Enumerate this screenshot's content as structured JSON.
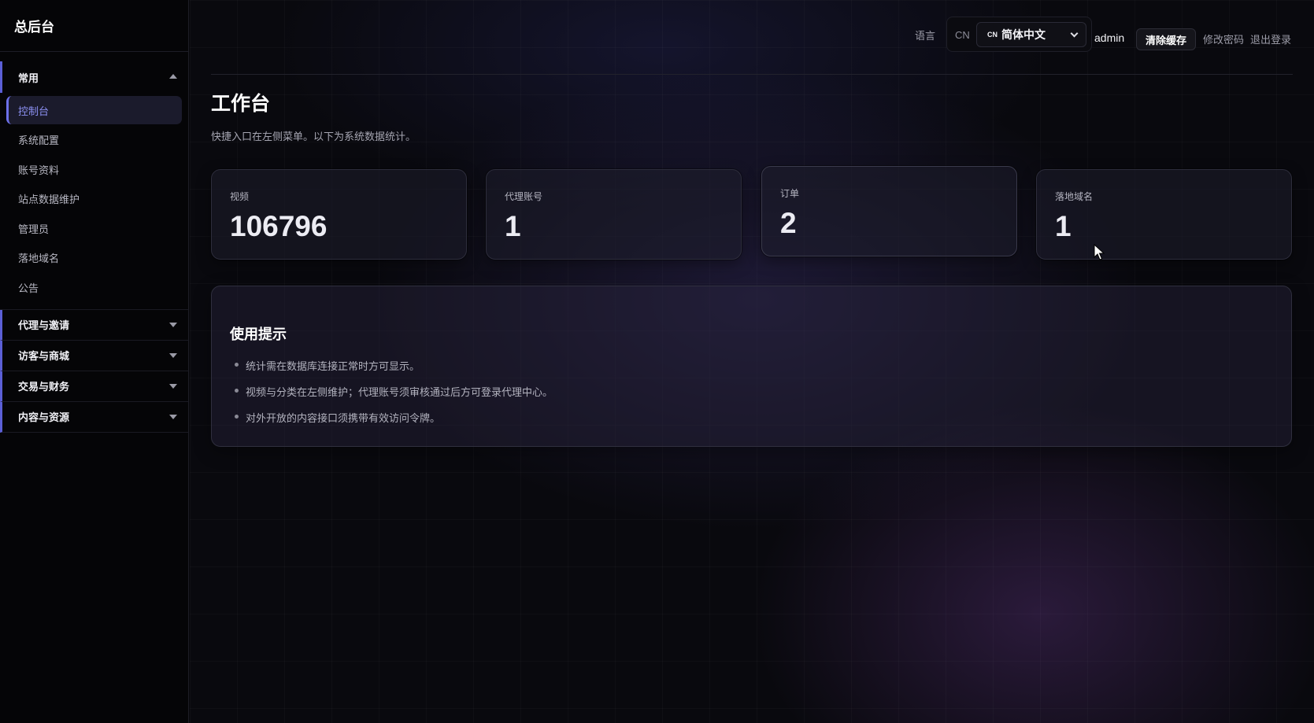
{
  "sidebar": {
    "brand": "总后台",
    "groups": [
      {
        "label": "常用",
        "expanded": true,
        "items": [
          {
            "label": "控制台",
            "active": true
          },
          {
            "label": "系统配置"
          },
          {
            "label": "账号资料"
          },
          {
            "label": "站点数据维护"
          },
          {
            "label": "管理员"
          },
          {
            "label": "落地域名"
          },
          {
            "label": "公告"
          }
        ]
      },
      {
        "label": "代理与邀请",
        "expanded": false
      },
      {
        "label": "访客与商城",
        "expanded": false
      },
      {
        "label": "交易与财务",
        "expanded": false
      },
      {
        "label": "内容与资源",
        "expanded": false
      }
    ]
  },
  "header": {
    "language_label": "语言",
    "language_code": "CN",
    "language_flag": "CN",
    "language_selected": "简体中文",
    "user": "admin",
    "clear_cache": "清除缓存",
    "change_password": "修改密码",
    "logout": "退出登录"
  },
  "page": {
    "title": "工作台",
    "subtitle": "快捷入口在左侧菜单。以下为系统数据统计。"
  },
  "stats": [
    {
      "label": "视频",
      "value": "106796"
    },
    {
      "label": "代理账号",
      "value": "1"
    },
    {
      "label": "订单",
      "value": "2"
    },
    {
      "label": "落地域名",
      "value": "1"
    }
  ],
  "tips": {
    "title": "使用提示",
    "items": [
      "统计需在数据库连接正常时方可显示。",
      "视频与分类在左侧维护；代理账号须审核通过后方可登录代理中心。",
      "对外开放的内容接口须携带有效访问令牌。"
    ]
  },
  "colors": {
    "accent": "#6c70e8",
    "background": "#09090e",
    "sidebar": "#050507"
  }
}
